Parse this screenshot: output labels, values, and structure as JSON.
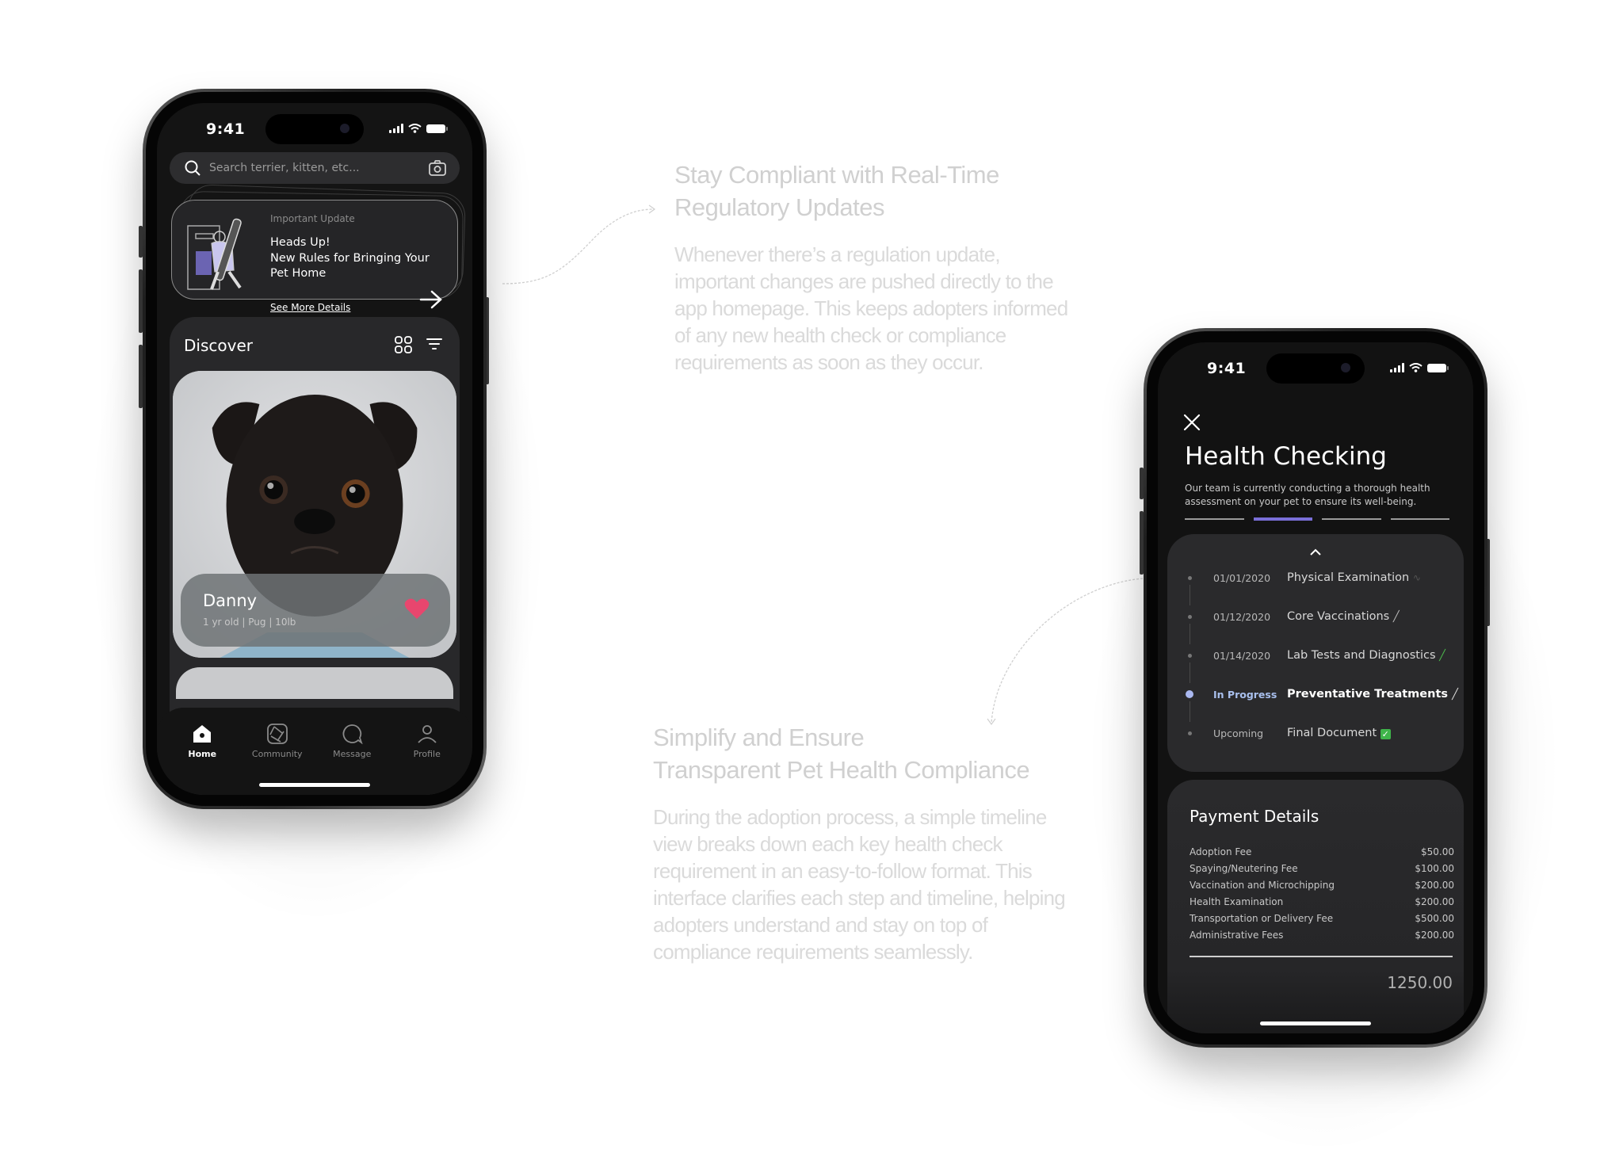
{
  "left_phone": {
    "status_bar": {
      "time": "9:41"
    },
    "search": {
      "placeholder": "Search terrier, kitten, etc...",
      "icon": "search-icon",
      "action_icon": "camera-icon"
    },
    "update_card": {
      "label": "Important Update",
      "title_line1": "Heads Up!",
      "title_line2": "New Rules for Bringing Your",
      "title_line3": "Pet Home",
      "link": "See More Details",
      "action_icon": "arrow-right-icon"
    },
    "discover": {
      "title": "Discover",
      "icons": [
        "grid-view-icon",
        "filter-icon"
      ],
      "pet": {
        "name": "Danny",
        "meta": "1 yr old | Pug | 10lb",
        "favorite": true
      }
    },
    "tab_bar": {
      "tabs": [
        {
          "label": "Home",
          "icon": "home-icon",
          "active": true
        },
        {
          "label": "Community",
          "icon": "aperture-icon",
          "active": false
        },
        {
          "label": "Message",
          "icon": "chat-bubble-icon",
          "active": false
        },
        {
          "label": "Profile",
          "icon": "user-icon",
          "active": false
        }
      ]
    }
  },
  "right_phone": {
    "status_bar": {
      "time": "9:41"
    },
    "title": "Health Checking",
    "description": "Our team is currently conducting a thorough health assessment on your pet to ensure its well-being.",
    "progress": {
      "total_steps": 4,
      "active_step": 2
    },
    "timeline": [
      {
        "date": "01/01/2020",
        "name": "Physical Examination",
        "icon": "stethoscope-icon",
        "state": "done"
      },
      {
        "date": "01/12/2020",
        "name": "Core Vaccinations",
        "icon": "syringe-icon",
        "state": "done"
      },
      {
        "date": "01/14/2020",
        "name": "Lab Tests and Diagnostics",
        "icon": "test-tube-icon",
        "state": "done"
      },
      {
        "date": "In Progress",
        "name": "Preventative Treatments",
        "icon": "pill-icon",
        "state": "active"
      },
      {
        "date": "Upcoming",
        "name": "Final Document",
        "icon": "check-box-icon",
        "state": "upcoming"
      }
    ],
    "payment": {
      "title": "Payment Details",
      "items": [
        {
          "label": "Adoption Fee",
          "amount": "$50.00"
        },
        {
          "label": "Spaying/Neutering Fee",
          "amount": "$100.00"
        },
        {
          "label": "Vaccination and Microchipping",
          "amount": "$200.00"
        },
        {
          "label": "Health Examination",
          "amount": "$200.00"
        },
        {
          "label": "Transportation or Delivery Fee",
          "amount": "$500.00"
        },
        {
          "label": "Administrative Fees",
          "amount": "$200.00"
        }
      ],
      "total": "1250.00"
    }
  },
  "section1": {
    "heading_line1": "Stay Compliant with Real-Time",
    "heading_line2": "Regulatory Updates",
    "body_lines": [
      "Whenever there’s a regulation update,",
      "important changes are pushed directly to the",
      "app homepage. This keeps adopters informed",
      "of any new health check or compliance",
      "requirements as soon as they occur."
    ]
  },
  "section2": {
    "heading_line1": "Simplify and Ensure",
    "heading_line2": "Transparent Pet Health Compliance",
    "body_lines": [
      "During the adoption process, a simple timeline",
      "view breaks down each key health check",
      "requirement in an easy-to-follow format. This",
      "interface clarifies each step and timeline, helping",
      "adopters understand and stay on top of",
      "compliance requirements seamlessly."
    ]
  },
  "colors": {
    "accent": "#7a6fd8",
    "in_progress": "#a9c0ee",
    "heart": "#e8466e",
    "check": "#3fb54a"
  }
}
